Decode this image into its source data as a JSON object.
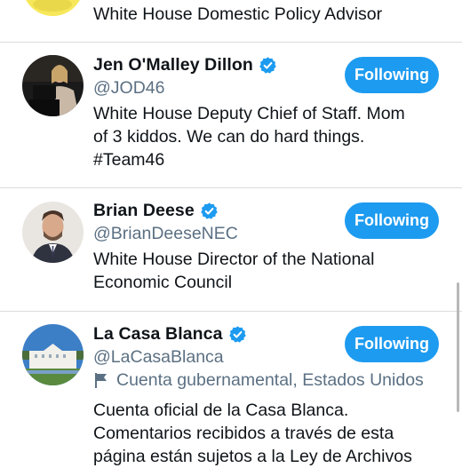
{
  "top_row": {
    "bio": "White House Domestic Policy Advisor"
  },
  "users": [
    {
      "name": "Jen O'Malley Dillon",
      "handle": "@JOD46",
      "bio_lines": [
        "White House Deputy Chief of Staff. Mom",
        "of 3 kiddos. We can do hard things.",
        "#Team46"
      ],
      "follow_label": "Following"
    },
    {
      "name": "Brian Deese",
      "handle": "@BrianDeeseNEC",
      "bio_lines": [
        "White House Director of the National",
        "Economic Council"
      ],
      "follow_label": "Following"
    },
    {
      "name": "La Casa Blanca",
      "handle": "@LaCasaBlanca",
      "label_text": "Cuenta gubernamental, Estados Unidos",
      "bio_lines": [
        "Cuenta oficial de la Casa Blanca.",
        "Comentarios recibidos a través de esta",
        "página están sujetos a la Ley de Archivos"
      ],
      "follow_label": "Following"
    }
  ],
  "colors": {
    "accent": "#1d9bf0",
    "secondary_text": "#5b7083",
    "divider": "#dcdcdc"
  },
  "icons": {
    "verified": "verified-badge-icon",
    "government_label": "flag-icon"
  }
}
